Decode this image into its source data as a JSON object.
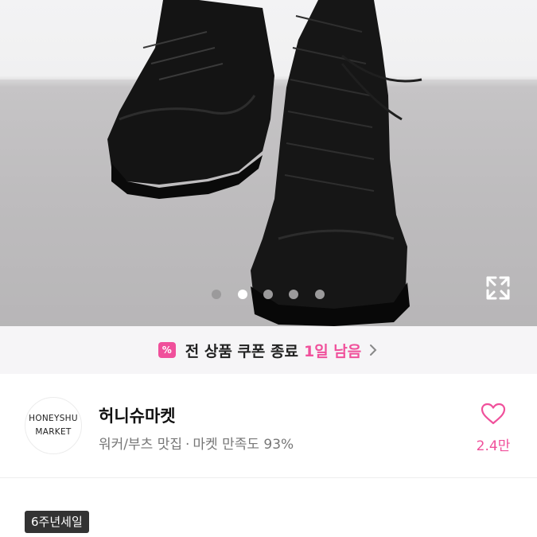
{
  "product_image": {
    "alt_icon": "lace-up-boots-photo",
    "carousel": {
      "total": 5,
      "active_index": 1
    },
    "fullscreen_icon": "expand-icon"
  },
  "coupon_banner": {
    "icon": "coupon-percent-icon",
    "icon_text": "%",
    "text": "전 상품 쿠폰 종료",
    "time_left": "1일 남음",
    "accent_color": "#f0509b"
  },
  "shop": {
    "logo_line1": "HONEYSHU",
    "logo_line2": "MARKET",
    "name": "허니슈마켓",
    "tagline": "워커/부츠 맛집",
    "separator": "·",
    "satisfaction": "마켓 만족도 93%",
    "like_icon": "heart-outline-icon",
    "like_count": "2.4만"
  },
  "tag": {
    "label": "6주년세일"
  }
}
